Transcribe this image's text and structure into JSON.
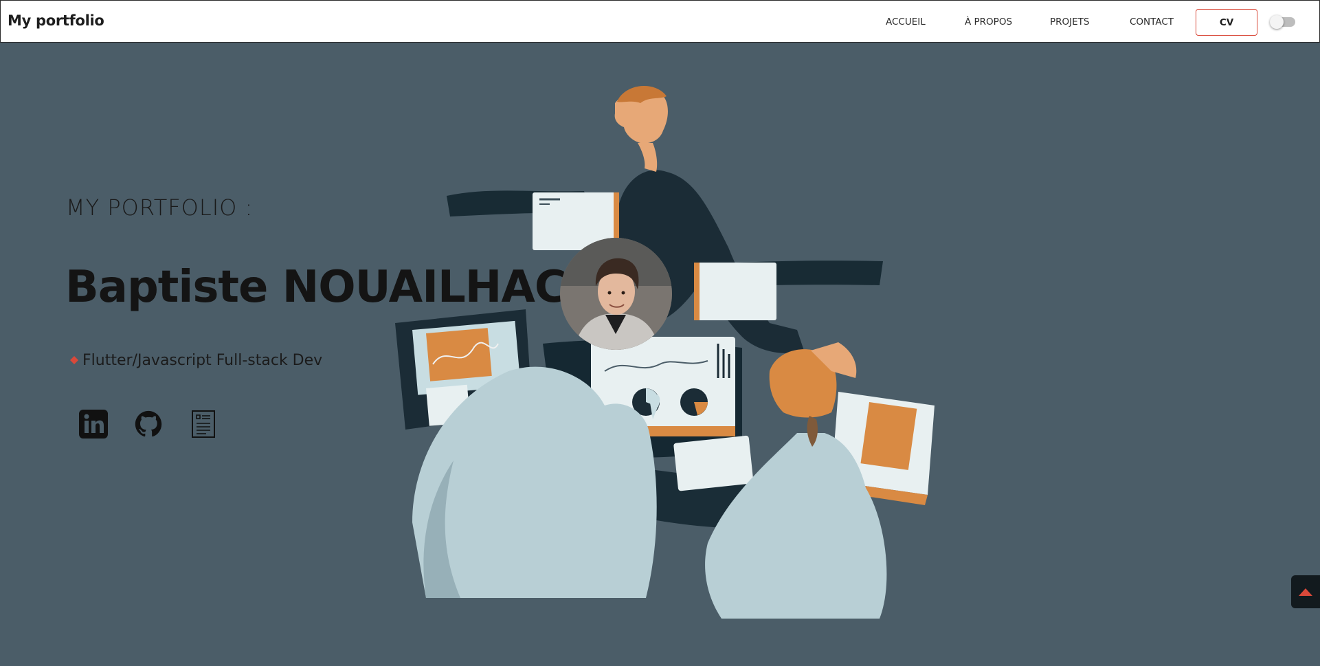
{
  "header": {
    "brand": "My portfolio",
    "nav": [
      {
        "label": "ACCUEIL"
      },
      {
        "label": "À PROPOS"
      },
      {
        "label": "PROJETS"
      },
      {
        "label": "CONTACT"
      }
    ],
    "cv_label": "CV",
    "theme_toggle_on": false
  },
  "hero": {
    "kicker": "MY PORTFOLIO :",
    "name": "Baptiste NOUAILHAC",
    "role": "Flutter/Javascript Full-stack Dev",
    "socials": [
      {
        "icon": "linkedin-icon"
      },
      {
        "icon": "github-icon"
      },
      {
        "icon": "resume-icon"
      }
    ]
  },
  "colors": {
    "background": "#4b5d68",
    "accent": "#d9493a",
    "navbar": "#ffffff",
    "text": "#141414",
    "illustration_dark": "#152832",
    "illustration_orange": "#d98a43",
    "illustration_light": "#c8dde2"
  },
  "scroll_top": {
    "icon": "arrow-up-icon"
  }
}
